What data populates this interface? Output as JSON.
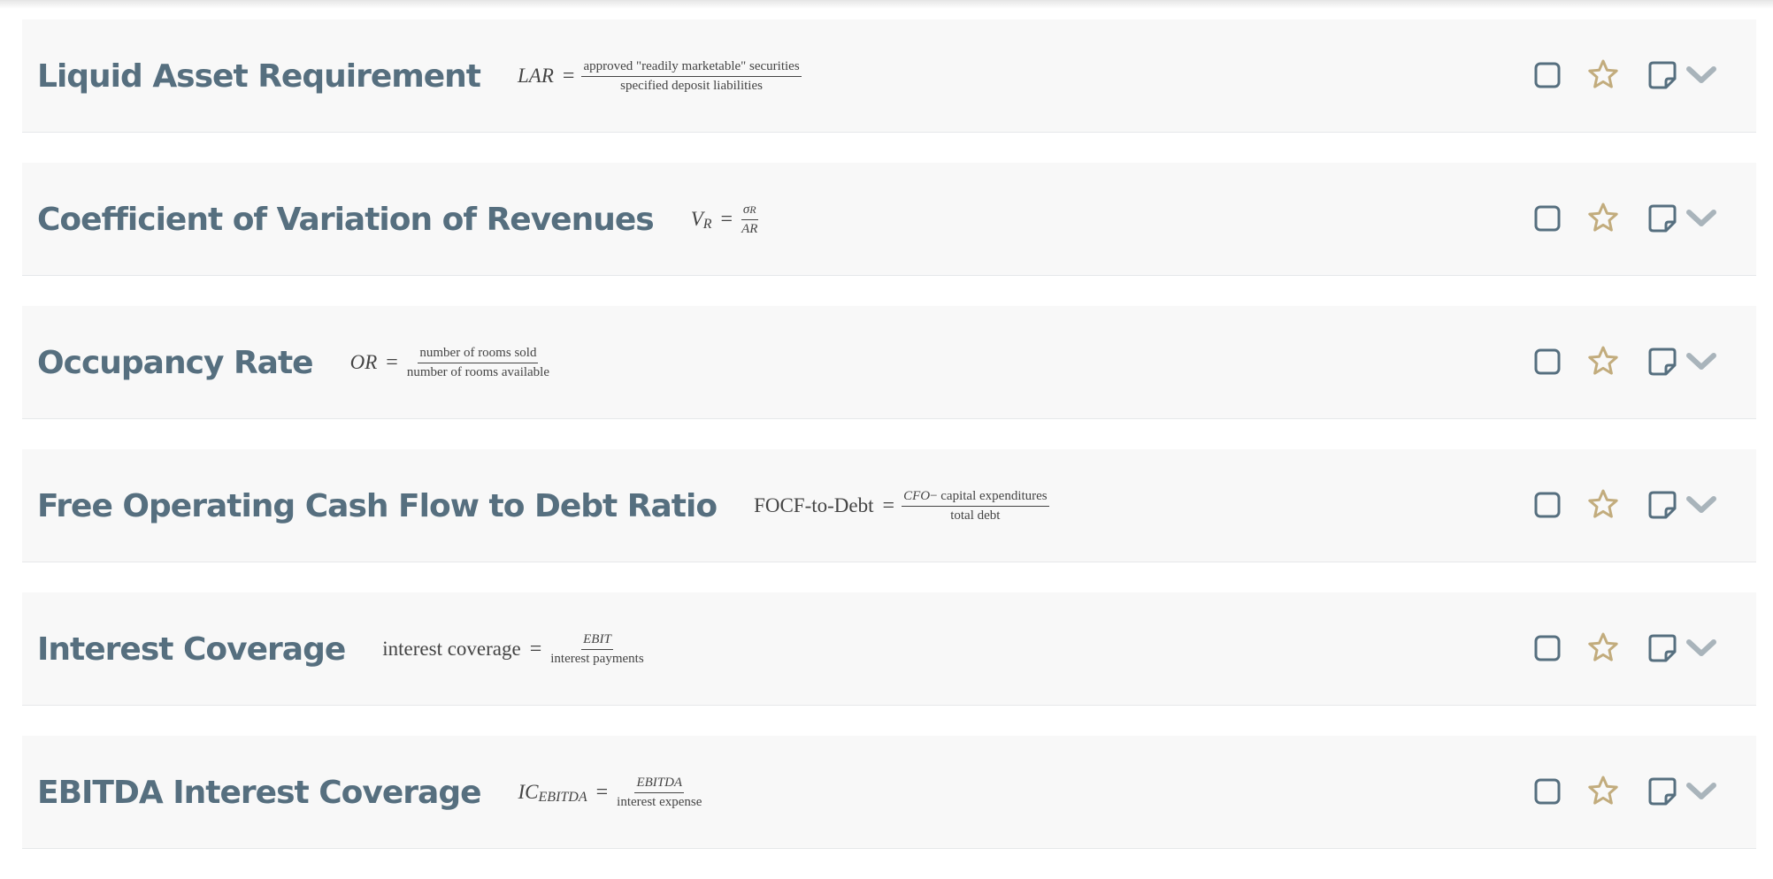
{
  "colors": {
    "title": "#566f7f",
    "formula_text": "#444444",
    "row_background": "#f8f8f8",
    "checkbox": "#566f7f",
    "star": "#c2ac7d",
    "note": "#566f7f",
    "chevron": "#a9b4bb"
  },
  "icons": {
    "checkbox": "checkbox-icon",
    "favorite": "star-icon",
    "note": "note-icon",
    "expand": "chevron-down-icon"
  },
  "items": [
    {
      "title": "Liquid Asset Requirement",
      "lhs": "LAR",
      "lhs_sub": "",
      "eq": "=",
      "num_a": "approved \"readily marketable\" securities",
      "num_b": "",
      "den": "specified deposit liabilities"
    },
    {
      "title": "Coefficient of Variation of Revenues",
      "lhs": "V",
      "lhs_sub": "R",
      "eq": "=",
      "num_a": "σ",
      "num_b": "R",
      "den": "AR"
    },
    {
      "title": "Occupancy Rate",
      "lhs": "OR",
      "lhs_sub": "",
      "eq": "=",
      "num_a": "number of rooms sold",
      "num_b": "",
      "den": "number of rooms available"
    },
    {
      "title": "Free Operating Cash Flow to Debt Ratio",
      "lhs": "FOCF-to-Debt",
      "lhs_sub": "",
      "eq": "=",
      "num_a": "CFO",
      "num_b": "− capital expenditures",
      "den": "total debt"
    },
    {
      "title": "Interest Coverage",
      "lhs": "interest coverage",
      "lhs_sub": "",
      "eq": "=",
      "num_a": "EBIT",
      "num_b": "",
      "den": "interest payments"
    },
    {
      "title": "EBITDA Interest Coverage",
      "lhs": "IC",
      "lhs_sub": "EBITDA",
      "eq": "=",
      "num_a": "EBITDA",
      "num_b": "",
      "den": "interest expense"
    }
  ]
}
